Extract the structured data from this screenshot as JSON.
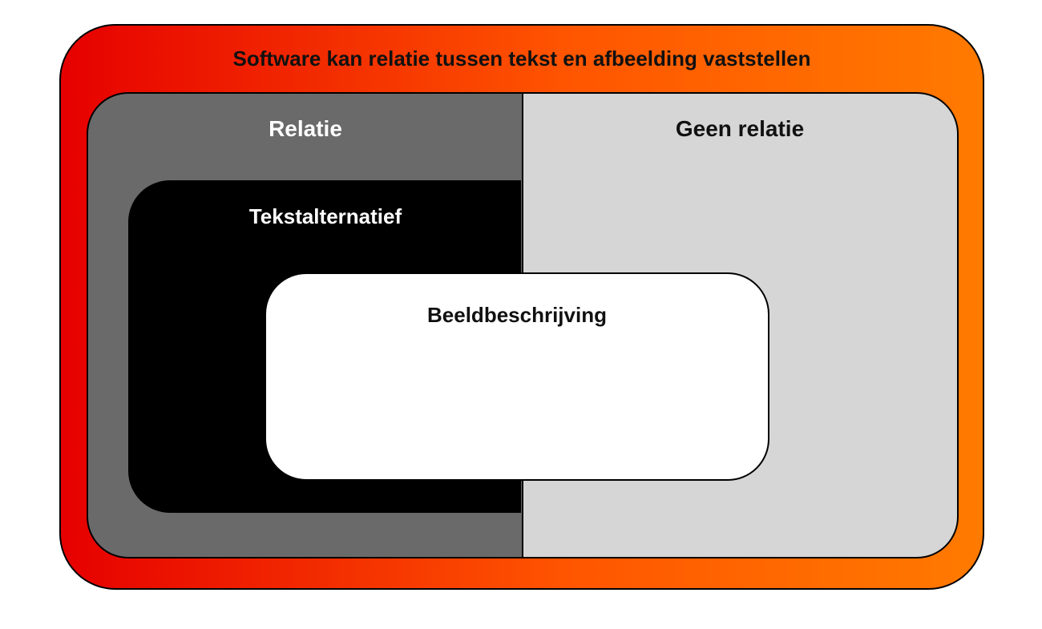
{
  "diagram": {
    "outer": {
      "title": "Software kan relatie tussen tekst en afbeelding vaststellen",
      "gradient_from": "#e60000",
      "gradient_to": "#ff7a00"
    },
    "split": {
      "left_label": "Relatie",
      "right_label": "Geen relatie",
      "left_color": "#6a6a6a",
      "right_color": "#d6d6d6"
    },
    "inner1": {
      "label": "Tekstalternatief",
      "color": "#000000"
    },
    "inner2": {
      "label": "Beeldbeschrijving",
      "color": "#ffffff"
    }
  }
}
